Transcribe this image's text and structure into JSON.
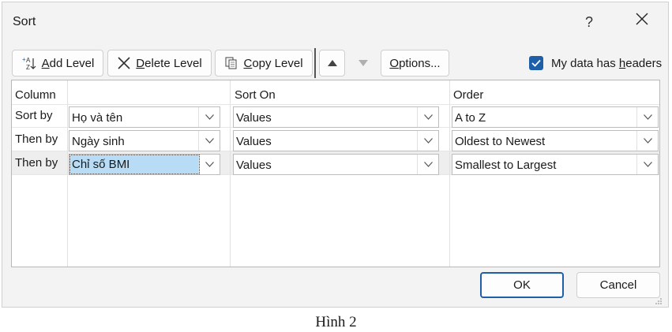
{
  "dialog": {
    "title": "Sort",
    "help_label": "?",
    "toolbar": {
      "add_level": {
        "prefix": "",
        "key": "A",
        "rest": "dd Level"
      },
      "delete_level": {
        "key": "D",
        "rest": "elete Level"
      },
      "copy_level": {
        "key": "C",
        "rest": "opy Level"
      },
      "options": {
        "key": "O",
        "rest": "ptions..."
      }
    },
    "headers_checkbox": {
      "checked": true,
      "before": "My data has ",
      "key": "h",
      "after": "eaders"
    },
    "columns": {
      "column": "Column",
      "sort_on": "Sort On",
      "order": "Order"
    },
    "rows": [
      {
        "label": "Sort by",
        "column": "Họ và tên",
        "sort_on": "Values",
        "order": "A to Z"
      },
      {
        "label": "Then by",
        "column": "Ngày sinh",
        "sort_on": "Values",
        "order": "Oldest to Newest"
      },
      {
        "label": "Then by",
        "column": "Chỉ số BMI",
        "sort_on": "Values",
        "order": "Smallest to Largest"
      }
    ],
    "ok_label": "OK",
    "cancel_label": "Cancel"
  },
  "caption": "Hình 2",
  "colors": {
    "accent": "#1f5fa8",
    "selection": "#b8dcf5"
  }
}
